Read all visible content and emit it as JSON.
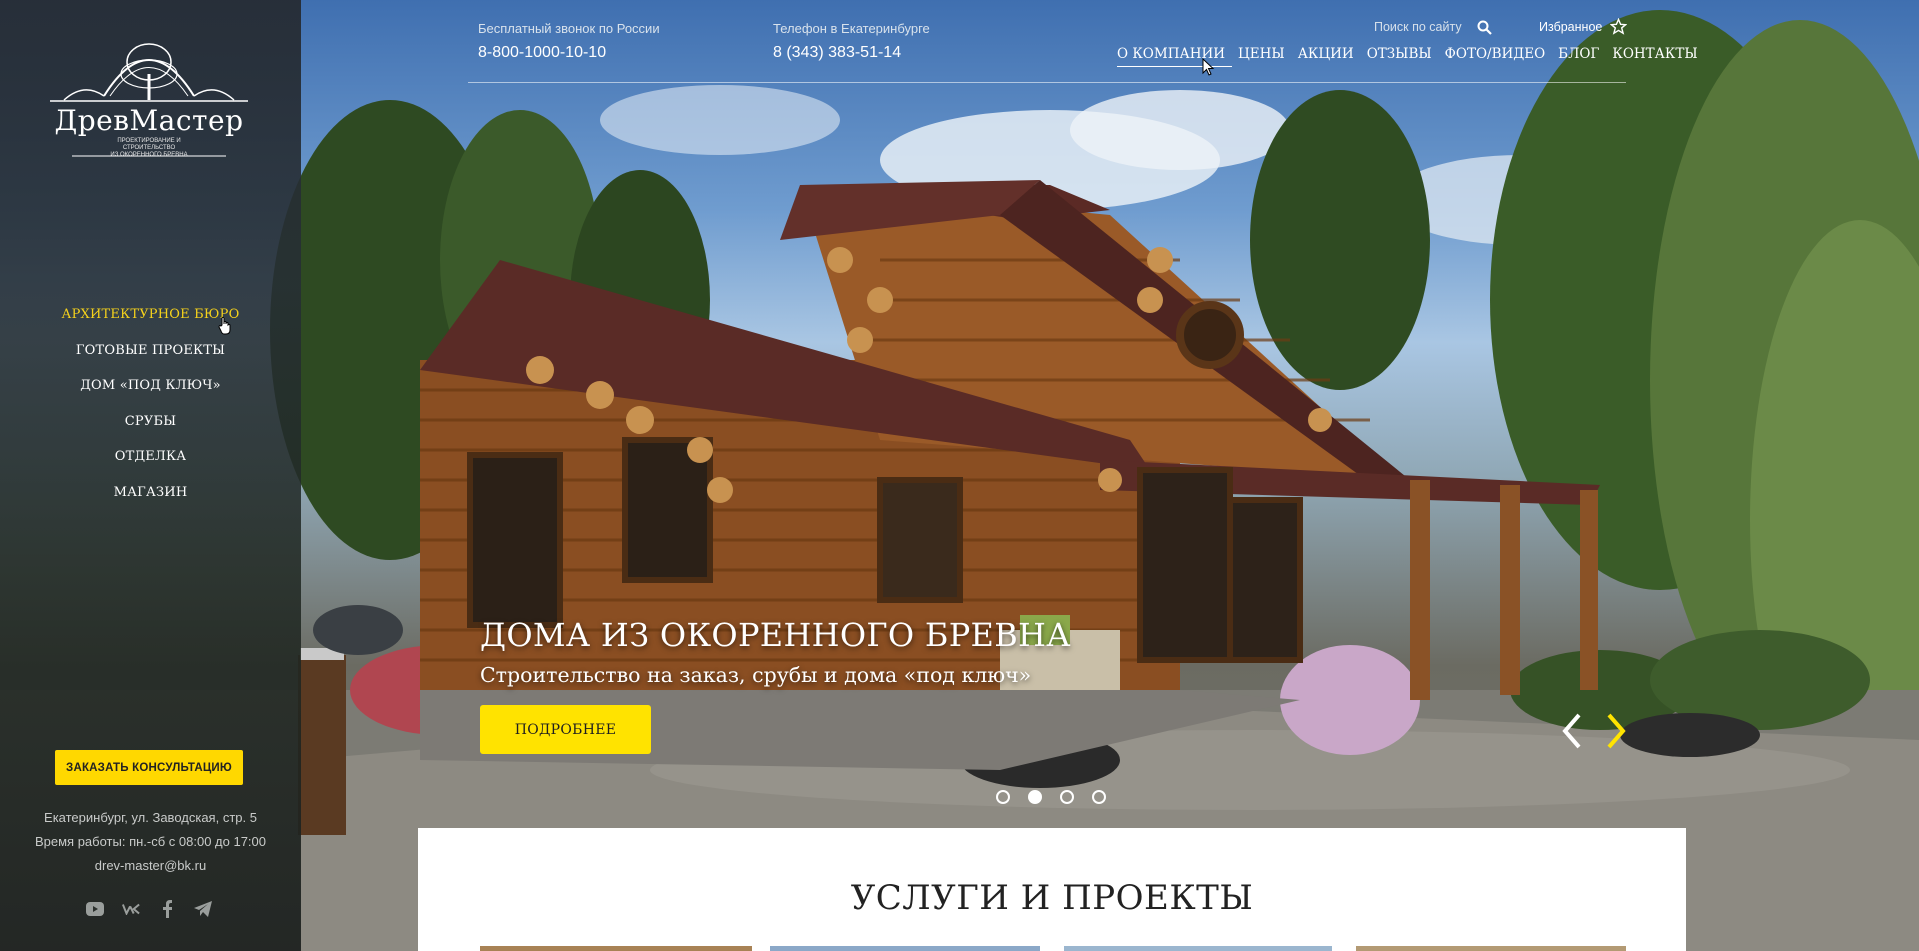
{
  "brand": {
    "name": "ДревМастер",
    "tagline_1": "ПРОЕКТИРОВАНИЕ И СТРОИТЕЛЬСТВО",
    "tagline_2": "ИЗ ОКОРЕННОГО БРЕВНА"
  },
  "sidebar": {
    "nav": [
      {
        "label": "АРХИТЕКТУРНОЕ БЮРО",
        "active": true
      },
      {
        "label": "ГОТОВЫЕ ПРОЕКТЫ"
      },
      {
        "label": "ДОМ «ПОД КЛЮЧ»"
      },
      {
        "label": "СРУБЫ"
      },
      {
        "label": "ОТДЕЛКА"
      },
      {
        "label": "МАГАЗИН"
      }
    ],
    "consult_button": "ЗАКАЗАТЬ КОНСУЛЬТАЦИЮ",
    "address": "Екатеринбург, ул. Заводская, стр. 5",
    "hours": "Время работы: пн.-сб с 08:00 до 17:00",
    "email": "drev-master@bk.ru",
    "socials": [
      "youtube-icon",
      "vk-icon",
      "facebook-icon",
      "telegram-icon"
    ]
  },
  "header": {
    "free_call_label": "Бесплатный звонок по России",
    "free_call_phone": "8-800-1000-10-10",
    "local_label": "Телефон в Екатеринбурге",
    "local_phone": "8 (343) 383-51-14",
    "search_placeholder": "Поиск по сайту",
    "favorites": "Избранное",
    "nav": [
      "О КОМПАНИИ",
      "ЦЕНЫ",
      "АКЦИИ",
      "ОТЗЫВЫ",
      "ФОТО/ВИДЕО",
      "БЛОГ",
      "КОНТАКТЫ"
    ]
  },
  "slider": {
    "title": "ДОМА ИЗ ОКОРЕННОГО БРЕВНА",
    "subtitle": "Строительство на заказ, срубы и дома «под ключ»",
    "button": "ПОДРОБНЕЕ",
    "slide_count": 4,
    "active_slide": 2
  },
  "services": {
    "heading": "УСЛУГИ И ПРОЕКТЫ"
  },
  "colors": {
    "accent_yellow": "#ffe300",
    "active_nav": "#f6d21c",
    "sidebar_bg": "#262c34"
  }
}
